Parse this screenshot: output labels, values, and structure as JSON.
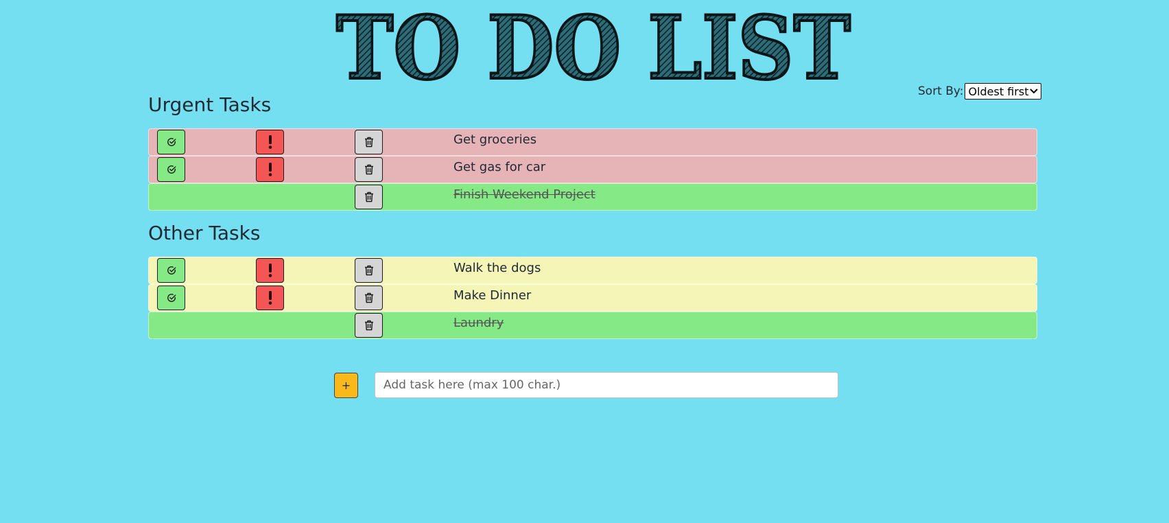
{
  "header": {
    "logo_text": "TO DO LIST"
  },
  "sort": {
    "label": "Sort By:",
    "selected": "Oldest first"
  },
  "sections": {
    "urgent": {
      "title": "Urgent Tasks",
      "tasks": [
        {
          "text": "Get groceries",
          "state": "urgent"
        },
        {
          "text": "Get gas for car",
          "state": "urgent"
        },
        {
          "text": "Finish Weekend Project",
          "state": "done"
        }
      ]
    },
    "other": {
      "title": "Other Tasks",
      "tasks": [
        {
          "text": "Walk the dogs",
          "state": "normal"
        },
        {
          "text": "Make Dinner",
          "state": "normal"
        },
        {
          "text": "Laundry",
          "state": "done"
        }
      ]
    }
  },
  "add_task": {
    "button_label": "+",
    "placeholder": "Add task here (max 100 char.)",
    "value": ""
  },
  "icons": {
    "complete": "check-circle-icon",
    "urgent": "exclamation-icon",
    "delete": "trash-icon",
    "dropdown": "chevron-down-icon"
  },
  "colors": {
    "background": "#74dff0",
    "urgent_row": "#e6b4b7",
    "normal_row": "#f5f5b8",
    "done_row": "#85ea85",
    "complete_button": "#85ea85",
    "urgent_button": "#f45555",
    "delete_button": "#d5d5d5",
    "add_button": "#f9b91a"
  }
}
